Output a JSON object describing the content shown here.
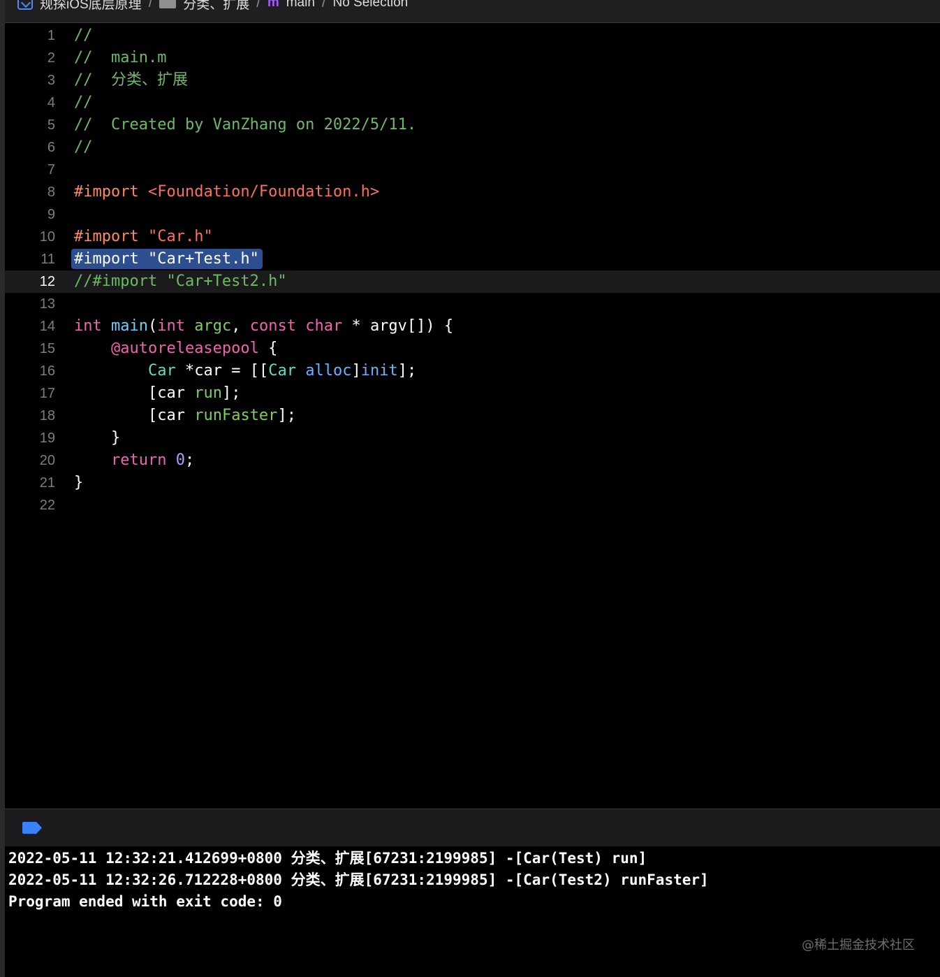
{
  "breadcrumb": {
    "project": "规探iOS底层原理",
    "folder": "分类、扩展",
    "file_icon": "m",
    "file": "main",
    "selection": "No Selection"
  },
  "icons": {
    "project": "xcode-project-icon",
    "folder": "folder-icon",
    "file": "objc-m-file-icon",
    "breakpoint": "breakpoint-toggle-icon"
  },
  "colors": {
    "comment": "#6bbb63",
    "preprocessor": "#ff8a60",
    "string": "#ff6f5e",
    "keyword": "#f262b4",
    "selection": "#2e4f8f",
    "breakpoint": "#3a82f7"
  },
  "editor": {
    "current_line": 12,
    "lines": [
      {
        "n": "1",
        "text": "//"
      },
      {
        "n": "2",
        "text": "//  main.m"
      },
      {
        "n": "3",
        "text": "//  分类、扩展"
      },
      {
        "n": "4",
        "text": "//"
      },
      {
        "n": "5",
        "text": "//  Created by VanZhang on 2022/5/11."
      },
      {
        "n": "6",
        "text": "//"
      },
      {
        "n": "7",
        "text": ""
      },
      {
        "n": "8",
        "text": "#import <Foundation/Foundation.h>"
      },
      {
        "n": "9",
        "text": ""
      },
      {
        "n": "10",
        "text": "#import \"Car.h\""
      },
      {
        "n": "11",
        "text": "#import \"Car+Test.h\""
      },
      {
        "n": "12",
        "text": "//#import \"Car+Test2.h\""
      },
      {
        "n": "13",
        "text": ""
      },
      {
        "n": "14",
        "text": "int main(int argc, const char * argv[]) {"
      },
      {
        "n": "15",
        "text": "    @autoreleasepool {"
      },
      {
        "n": "16",
        "text": "        Car *car = [[Car alloc]init];"
      },
      {
        "n": "17",
        "text": "        [car run];"
      },
      {
        "n": "18",
        "text": "        [car runFaster];"
      },
      {
        "n": "19",
        "text": "    }"
      },
      {
        "n": "20",
        "text": "    return 0;"
      },
      {
        "n": "21",
        "text": "}"
      },
      {
        "n": "22",
        "text": ""
      }
    ]
  },
  "console": {
    "lines": [
      "2022-05-11 12:32:21.412699+0800 分类、扩展[67231:2199985] -[Car(Test) run]",
      "2022-05-11 12:32:26.712228+0800 分类、扩展[67231:2199985] -[Car(Test2) runFaster]",
      "Program ended with exit code: 0"
    ]
  },
  "watermark": "@稀土掘金技术社区"
}
